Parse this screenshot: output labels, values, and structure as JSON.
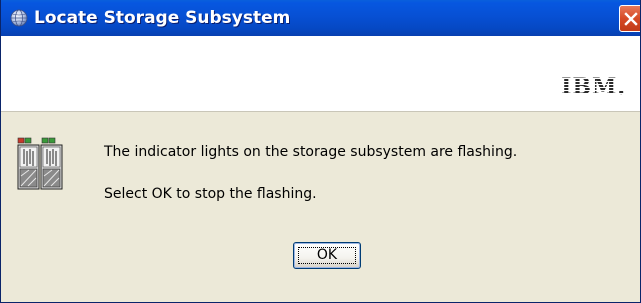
{
  "window": {
    "title": "Locate Storage Subsystem",
    "title_icon": "globe-icon",
    "close_icon": "close-icon"
  },
  "banner": {
    "logo_text": "IBM."
  },
  "message": {
    "icon": "storage-subsystem-icon",
    "line1": "The indicator lights on the storage subsystem are flashing.",
    "line2": "Select OK to stop the flashing."
  },
  "buttons": {
    "ok_label": "OK"
  },
  "colors": {
    "titlebar": "#0750d4",
    "close_button": "#d64a26",
    "dialog_background": "#ece9d8",
    "indicator_green": "#3a9a3a",
    "indicator_red": "#c8382a"
  }
}
